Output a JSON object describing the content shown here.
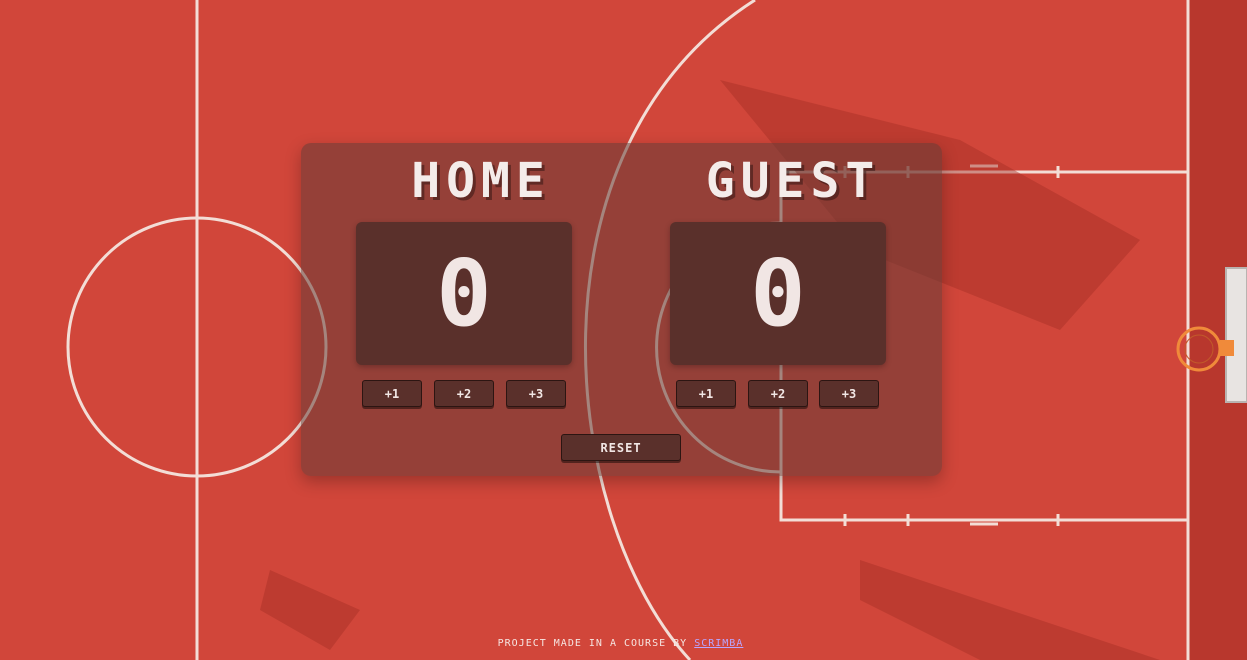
{
  "colors": {
    "court": "#d1463a",
    "court_lines": "#f3ddd6",
    "panel": "#5a302b",
    "text": "#f1e6e4",
    "link": "#b9a6ff"
  },
  "home": {
    "title": "HOME",
    "score": "0",
    "buttons": [
      "+1",
      "+2",
      "+3"
    ]
  },
  "guest": {
    "title": "GUEST",
    "score": "0",
    "buttons": [
      "+1",
      "+2",
      "+3"
    ]
  },
  "reset_label": "RESET",
  "footer": {
    "text": "PROJECT MADE IN A COURSE BY ",
    "link_text": "SCRIMBA"
  }
}
